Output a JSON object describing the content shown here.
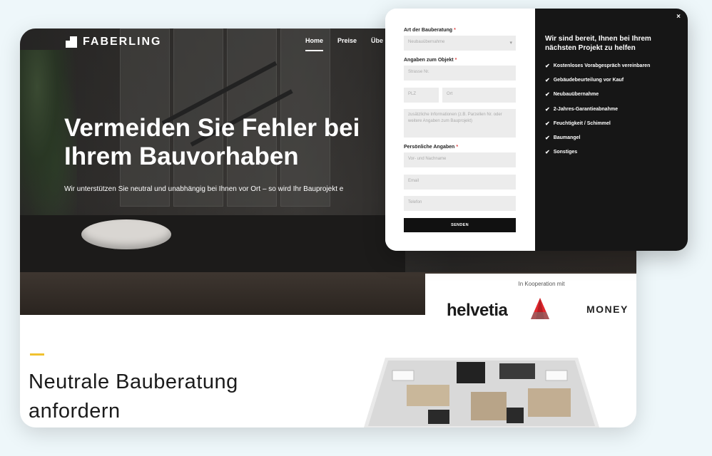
{
  "brand": {
    "name": "FABERLING"
  },
  "nav": {
    "items": [
      {
        "label": "Home"
      },
      {
        "label": "Preise"
      },
      {
        "label": "Übe"
      }
    ]
  },
  "hero": {
    "title": "Vermeiden Sie Fehler bei Ihrem Bauvorhaben",
    "subtitle": "Wir unterstützen Sie neutral und unabhängig bei Ihnen vor Ort – so wird Ihr Bauprojekt e"
  },
  "cooperation": {
    "label": "In Kooperation mit",
    "partner1": "helvetia",
    "partner2": "MONEY"
  },
  "section": {
    "title": "Neutrale Bauberatung anfordern"
  },
  "form": {
    "close_label": "×",
    "type_label": "Art der Bauberatung",
    "type_value": "Neubauübernahme",
    "object_label": "Angaben zum Objekt",
    "street_placeholder": "Strasse Nr.",
    "zip_placeholder": "PLZ",
    "city_placeholder": "Ort",
    "info_placeholder": "zusätzliche Informationen (z.B. Parzellen Nr. oder weitere Angaben zum Bauprojekt)",
    "personal_label": "Persönliche Angaben",
    "name_placeholder": "Vor- und Nachname",
    "email_placeholder": "Email",
    "phone_placeholder": "Telefon",
    "send_label": "SENDEN",
    "required_mark": "*"
  },
  "info": {
    "title": "Wir sind bereit, Ihnen bei Ihrem nächsten Projekt zu helfen",
    "check_icon": "✔",
    "items": [
      {
        "label": "Kostenloses Vorabgespräch vereinbaren"
      },
      {
        "label": "Gebäudebeurteilung vor Kauf"
      },
      {
        "label": "Neubauübernahme"
      },
      {
        "label": "2-Jahres-Garantieabnahme"
      },
      {
        "label": "Feuchtigkeit / Schimmel"
      },
      {
        "label": "Baumangel"
      },
      {
        "label": "Sonstiges"
      }
    ]
  },
  "colors": {
    "accent": "#f0c12f",
    "dark": "#161616",
    "helvetia_red": "#e0282e"
  }
}
